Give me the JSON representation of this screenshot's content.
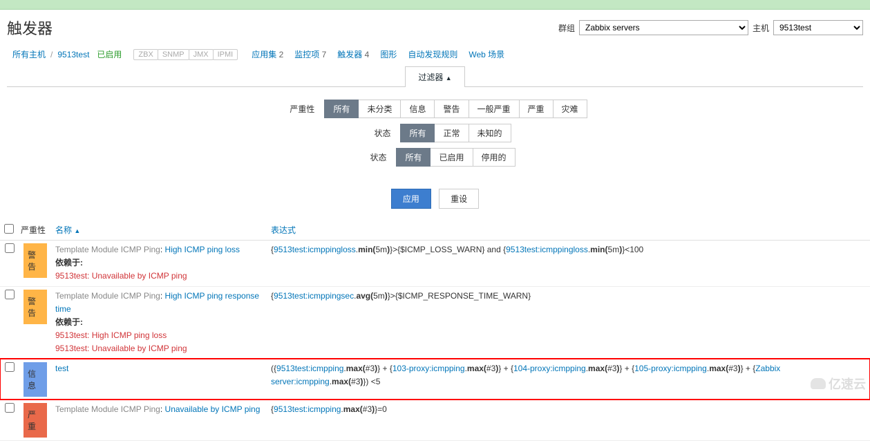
{
  "page": {
    "title": "触发器"
  },
  "selectors": {
    "group_label": "群组",
    "group_value": "Zabbix servers",
    "host_label": "主机",
    "host_value": "9513test"
  },
  "nav": {
    "all_hosts": "所有主机",
    "current_host": "9513test",
    "enabled": "已启用",
    "tags": [
      "ZBX",
      "SNMP",
      "JMX",
      "IPMI"
    ],
    "links": [
      {
        "label": "应用集",
        "count": "2"
      },
      {
        "label": "监控项",
        "count": "7"
      },
      {
        "label": "触发器",
        "count": "4",
        "active": true
      },
      {
        "label": "图形",
        "count": ""
      },
      {
        "label": "自动发现规则",
        "count": ""
      },
      {
        "label": "Web 场景",
        "count": ""
      }
    ]
  },
  "filter": {
    "tab_label": "过滤器",
    "rows": [
      {
        "label": "严重性",
        "options": [
          "所有",
          "未分类",
          "信息",
          "警告",
          "一般严重",
          "严重",
          "灾难"
        ],
        "active": 0
      },
      {
        "label": "状态",
        "options": [
          "所有",
          "正常",
          "未知的"
        ],
        "active": 0
      },
      {
        "label": "状态",
        "options": [
          "所有",
          "已启用",
          "停用的"
        ],
        "active": 0
      }
    ],
    "apply": "应用",
    "reset": "重设"
  },
  "table": {
    "headers": {
      "severity": "严重性",
      "name": "名称",
      "expression": "表达式"
    },
    "rows": [
      {
        "sev_class": "sev-warn",
        "sev_text": "警告",
        "tmpl": "Template Module ICMP Ping",
        "name": "High ICMP ping loss",
        "dep_label": "依赖于:",
        "deps": [
          "9513test: Unavailable by ICMP ping"
        ],
        "expr_parts": [
          {
            "t": "{"
          },
          {
            "a": "9513test:icmppingloss"
          },
          {
            "t": ".min(5m)}>{$ICMP_LOSS_WARN} and {"
          },
          {
            "a": "9513test:icmppingloss"
          },
          {
            "t": ".min(5m)}<100"
          }
        ]
      },
      {
        "sev_class": "sev-warn",
        "sev_text": "警告",
        "tmpl": "Template Module ICMP Ping",
        "name": "High ICMP ping response time",
        "dep_label": "依赖于:",
        "deps": [
          "9513test: High ICMP ping loss",
          "9513test: Unavailable by ICMP ping"
        ],
        "expr_parts": [
          {
            "t": "{"
          },
          {
            "a": "9513test:icmppingsec"
          },
          {
            "t": ".avg(5m)}>{$ICMP_RESPONSE_TIME_WARN}"
          }
        ]
      },
      {
        "sev_class": "sev-info",
        "sev_text": "信息",
        "highlight": true,
        "tmpl": "",
        "name": "test",
        "expr_parts": [
          {
            "t": "({"
          },
          {
            "a": "9513test:icmpping"
          },
          {
            "t": ".max(#3)} + {"
          },
          {
            "a": "103-proxy:icmpping"
          },
          {
            "t": ".max(#3)} + {"
          },
          {
            "a": "104-proxy:icmpping"
          },
          {
            "t": ".max(#3)} + {"
          },
          {
            "a": "105-proxy:icmpping"
          },
          {
            "t": ".max(#3)} + {"
          },
          {
            "a": "Zabbix server:icmpping"
          },
          {
            "t": ".max(#3)}) <5"
          }
        ]
      },
      {
        "sev_class": "sev-high",
        "sev_text": "严重",
        "tmpl": "Template Module ICMP Ping",
        "name": "Unavailable by ICMP ping",
        "expr_parts": [
          {
            "t": "{"
          },
          {
            "a": "9513test:icmpping"
          },
          {
            "t": ".max(#3)}=0"
          }
        ]
      }
    ]
  },
  "watermark": "亿速云"
}
